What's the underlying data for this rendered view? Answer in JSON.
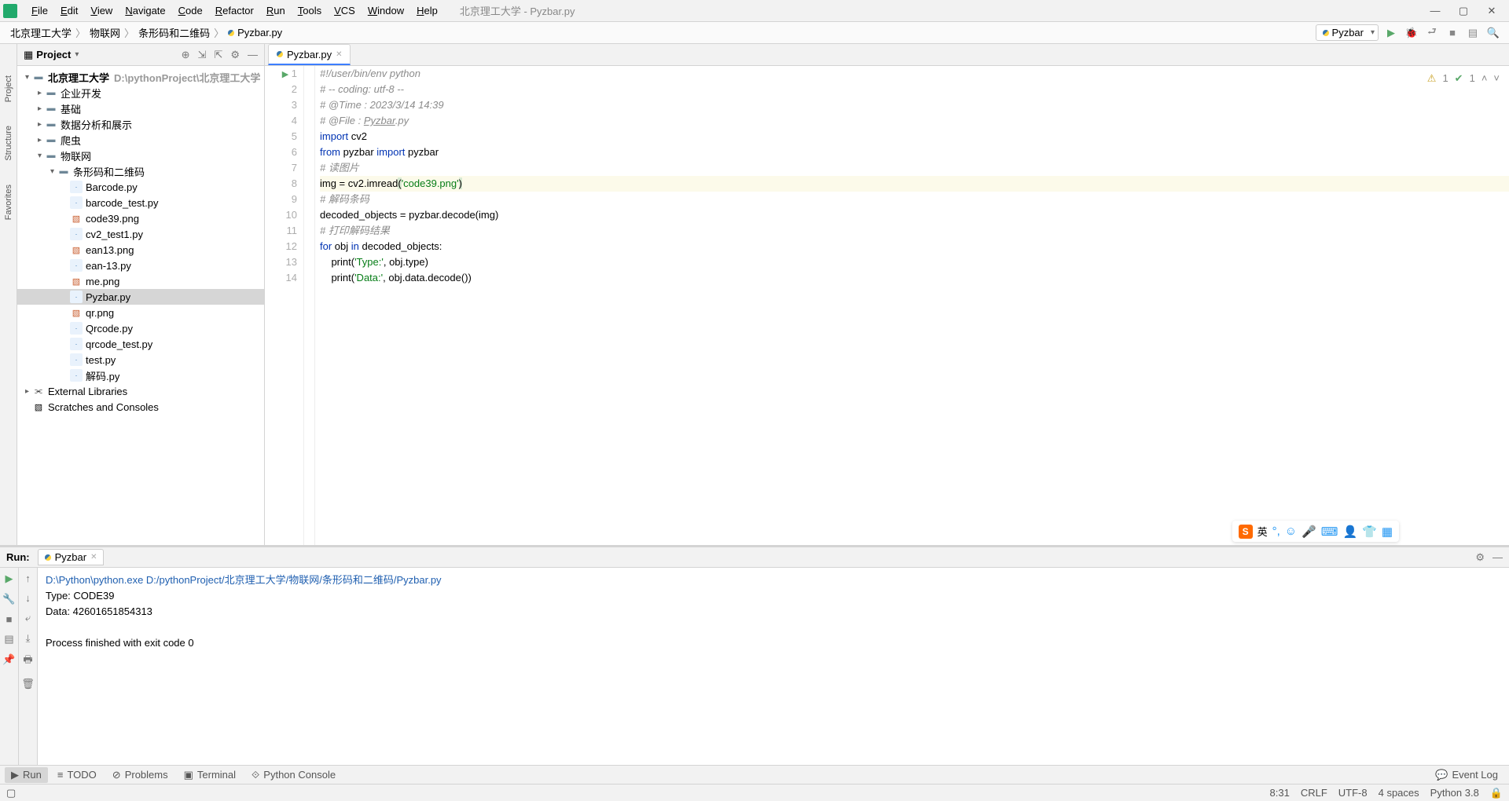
{
  "window": {
    "title": "北京理工大学 - Pyzbar.py"
  },
  "menu": [
    "File",
    "Edit",
    "View",
    "Navigate",
    "Code",
    "Refactor",
    "Run",
    "Tools",
    "VCS",
    "Window",
    "Help"
  ],
  "breadcrumbs": [
    "北京理工大学",
    "物联网",
    "条形码和二维码",
    "Pyzbar.py"
  ],
  "run_config": "Pyzbar",
  "project_panel": {
    "title": "Project",
    "root": {
      "name": "北京理工大学",
      "path": "D:\\pythonProject\\北京理工大学"
    },
    "folders_l1": [
      "企业开发",
      "基础",
      "数据分析和展示",
      "爬虫"
    ],
    "folder_iot": "物联网",
    "folder_barcode": "条形码和二维码",
    "files": [
      "Barcode.py",
      "barcode_test.py",
      "code39.png",
      "cv2_test1.py",
      "ean13.png",
      "ean-13.py",
      "me.png",
      "Pyzbar.py",
      "qr.png",
      "Qrcode.py",
      "qrcode_test.py",
      "test.py",
      "解码.py"
    ],
    "selected": "Pyzbar.py",
    "ext": [
      "External Libraries",
      "Scratches and Consoles"
    ]
  },
  "tab_name": "Pyzbar.py",
  "inspection": {
    "warn": "1",
    "ok": "1"
  },
  "code_lines": [
    {
      "n": 1,
      "segs": [
        {
          "t": "#!/user/bin/env python",
          "c": "c-comment"
        }
      ]
    },
    {
      "n": 2,
      "segs": [
        {
          "t": "# -- coding: utf-8 --",
          "c": "c-comment"
        }
      ]
    },
    {
      "n": 3,
      "segs": [
        {
          "t": "# @Time : 2023/3/14 14:39",
          "c": "c-comment"
        }
      ]
    },
    {
      "n": 4,
      "segs": [
        {
          "t": "# @File : ",
          "c": "c-comment"
        },
        {
          "t": "Pyzbar",
          "c": "c-comment",
          "u": true
        },
        {
          "t": ".py",
          "c": "c-comment"
        }
      ]
    },
    {
      "n": 5,
      "segs": [
        {
          "t": "import ",
          "c": "c-kw"
        },
        {
          "t": "cv2",
          "c": "c-id"
        }
      ]
    },
    {
      "n": 6,
      "segs": [
        {
          "t": "from ",
          "c": "c-kw"
        },
        {
          "t": "pyzbar ",
          "c": "c-id"
        },
        {
          "t": "import ",
          "c": "c-kw"
        },
        {
          "t": "pyzbar",
          "c": "c-id"
        }
      ]
    },
    {
      "n": 7,
      "segs": [
        {
          "t": "# 读图片",
          "c": "c-comment"
        }
      ]
    },
    {
      "n": 8,
      "hl": true,
      "segs": [
        {
          "t": "img = cv2.imread",
          "c": "c-id"
        },
        {
          "t": "(",
          "c": "c-id",
          "bg": "c-strhl"
        },
        {
          "t": "'code39.png'",
          "c": "c-str"
        },
        {
          "t": ")",
          "c": "c-id",
          "bg": "c-strhl"
        }
      ]
    },
    {
      "n": 9,
      "segs": [
        {
          "t": "# 解码条码",
          "c": "c-comment"
        }
      ]
    },
    {
      "n": 10,
      "segs": [
        {
          "t": "decoded_objects = pyzbar.decode(img)",
          "c": "c-id"
        }
      ]
    },
    {
      "n": 11,
      "segs": [
        {
          "t": "# 打印解码结果",
          "c": "c-comment"
        }
      ]
    },
    {
      "n": 12,
      "segs": [
        {
          "t": "for ",
          "c": "c-kw"
        },
        {
          "t": "obj ",
          "c": "c-id"
        },
        {
          "t": "in ",
          "c": "c-kw"
        },
        {
          "t": "decoded_objects:",
          "c": "c-id"
        }
      ]
    },
    {
      "n": 13,
      "segs": [
        {
          "t": "    print(",
          "c": "c-id"
        },
        {
          "t": "'Type:'",
          "c": "c-str"
        },
        {
          "t": ", obj.type)",
          "c": "c-id"
        }
      ]
    },
    {
      "n": 14,
      "segs": [
        {
          "t": "    print(",
          "c": "c-id"
        },
        {
          "t": "'Data:'",
          "c": "c-str"
        },
        {
          "t": ", obj.data.decode())",
          "c": "c-id"
        }
      ]
    }
  ],
  "run_panel": {
    "label": "Run:",
    "tab": "Pyzbar",
    "lines": [
      {
        "t": "D:\\Python\\python.exe D:/pythonProject/北京理工大学/物联网/条形码和二维码/Pyzbar.py",
        "cls": "path"
      },
      {
        "t": "Type: CODE39",
        "cls": ""
      },
      {
        "t": "Data: 42601651854313",
        "cls": ""
      },
      {
        "t": "",
        "cls": ""
      },
      {
        "t": "Process finished with exit code 0",
        "cls": "exit"
      }
    ]
  },
  "bottom_buttons": [
    {
      "label": "Run",
      "icon": "▶"
    },
    {
      "label": "TODO",
      "icon": "≡"
    },
    {
      "label": "Problems",
      "icon": "⊘"
    },
    {
      "label": "Terminal",
      "icon": "▣"
    },
    {
      "label": "Python Console",
      "icon": "⟐"
    }
  ],
  "event_log": "Event Log",
  "status": {
    "pos": "8:31",
    "le": "CRLF",
    "enc": "UTF-8",
    "indent": "4 spaces",
    "sdk": "Python 3.8"
  },
  "sidebar_tabs": [
    "Project",
    "Structure",
    "Favorites"
  ],
  "ime_label": "英"
}
